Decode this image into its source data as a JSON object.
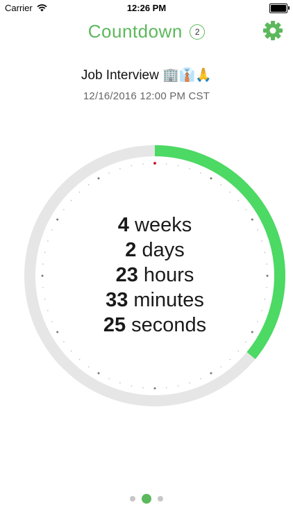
{
  "status_bar": {
    "carrier": "Carrier",
    "time": "12:26 PM",
    "battery_level": 1.0
  },
  "header": {
    "title": "Countdown",
    "badge_count": "2",
    "settings_icon": "gear-icon"
  },
  "event": {
    "title": "Job Interview 🏢👔🙏",
    "datetime": "12/16/2016 12:00 PM CST"
  },
  "countdown": {
    "weeks_value": "4",
    "weeks_unit": "weeks",
    "days_value": "2",
    "days_unit": "days",
    "hours_value": "23",
    "hours_unit": "hours",
    "minutes_value": "33",
    "minutes_unit": "minutes",
    "seconds_value": "25",
    "seconds_unit": "seconds"
  },
  "progress": {
    "fraction": 0.36
  },
  "pager": {
    "page_count": 3,
    "active_index": 1
  },
  "colors": {
    "accent": "#5cb85c",
    "progress": "#4cd964",
    "track": "#e6e6e6",
    "tick": "#bbbbbb",
    "tick_major": "#777777",
    "marker": "#d0021b"
  }
}
